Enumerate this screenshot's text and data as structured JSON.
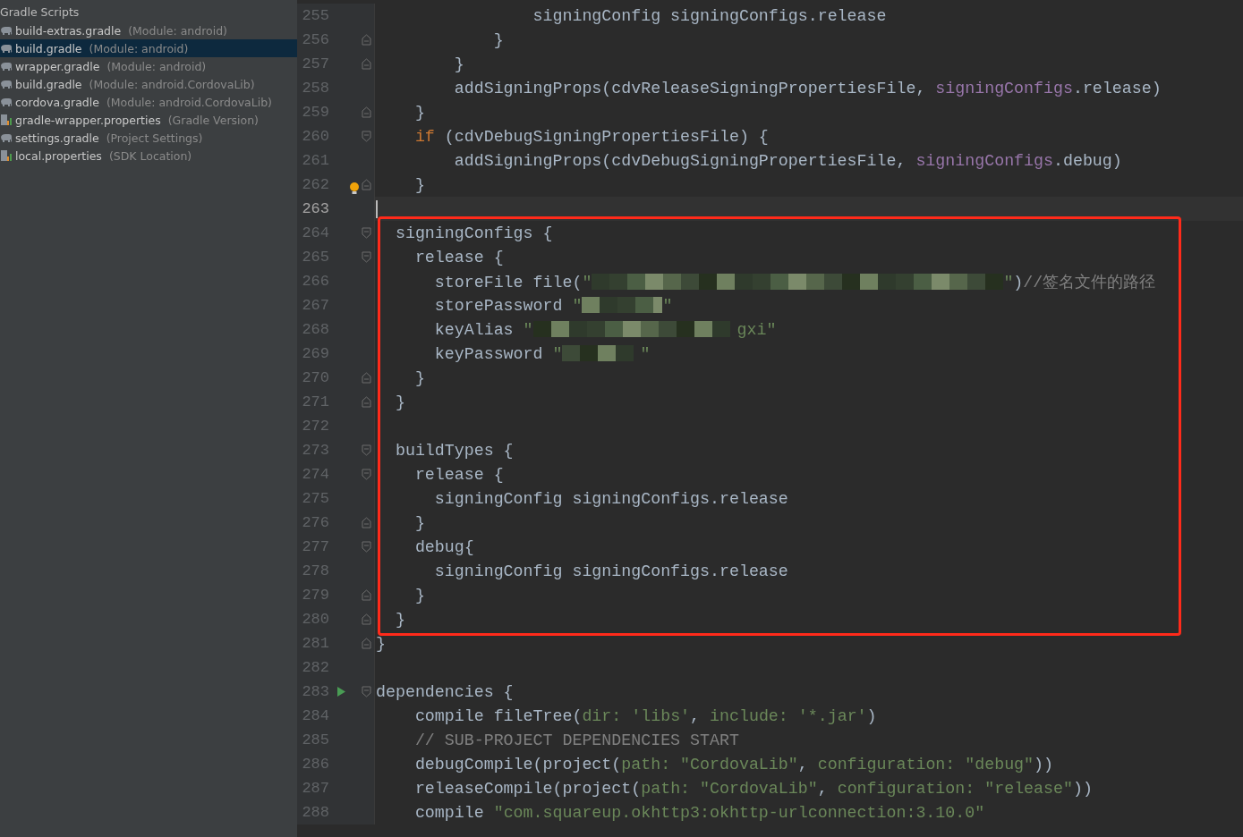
{
  "sidebar": {
    "header": "Gradle Scripts",
    "items": [
      {
        "name": "build-extras.gradle",
        "detail": "(Module: android)",
        "kind": "gradle",
        "selected": false
      },
      {
        "name": "build.gradle",
        "detail": "(Module: android)",
        "kind": "gradle",
        "selected": true
      },
      {
        "name": "wrapper.gradle",
        "detail": "(Module: android)",
        "kind": "gradle",
        "selected": false
      },
      {
        "name": "build.gradle",
        "detail": "(Module: android.CordovaLib)",
        "kind": "gradle",
        "selected": false
      },
      {
        "name": "cordova.gradle",
        "detail": "(Module: android.CordovaLib)",
        "kind": "gradle",
        "selected": false
      },
      {
        "name": "gradle-wrapper.properties",
        "detail": "(Gradle Version)",
        "kind": "properties",
        "selected": false
      },
      {
        "name": "settings.gradle",
        "detail": "(Project Settings)",
        "kind": "gradle",
        "selected": false
      },
      {
        "name": "local.properties",
        "detail": "(SDK Location)",
        "kind": "properties",
        "selected": false
      }
    ]
  },
  "editor": {
    "blocks": [
      {
        "kind": "plain",
        "lines": [
          {
            "number": "255",
            "current": false,
            "tokens": [
              {
                "text": "                signingConfig signingConfigs.release",
                "kind": "plain"
              }
            ]
          },
          {
            "number": "256",
            "current": false,
            "gutter_icons": [
              {
                "kind": "fold-end"
              }
            ],
            "tokens": [
              {
                "text": "            }",
                "kind": "plain"
              }
            ]
          },
          {
            "number": "257",
            "current": false,
            "gutter_icons": [
              {
                "kind": "fold-end"
              }
            ],
            "tokens": [
              {
                "text": "        }",
                "kind": "plain"
              }
            ]
          },
          {
            "number": "258",
            "current": false,
            "tokens": [
              {
                "text": "        addSigningProps(cdvReleaseSigningPropertiesFile, ",
                "kind": "plain"
              },
              {
                "text": "signingConfigs",
                "kind": "field"
              },
              {
                "text": ".release)",
                "kind": "plain"
              }
            ]
          },
          {
            "number": "259",
            "current": false,
            "gutter_icons": [
              {
                "kind": "fold-end"
              }
            ],
            "tokens": [
              {
                "text": "    }",
                "kind": "plain"
              }
            ]
          },
          {
            "number": "260",
            "current": false,
            "gutter_icons": [
              {
                "kind": "fold-start"
              }
            ],
            "tokens": [
              {
                "text": "    if",
                "kind": "keyword"
              },
              {
                "text": " (cdvDebugSigningPropertiesFile) {",
                "kind": "plain"
              }
            ]
          },
          {
            "number": "261",
            "current": false,
            "tokens": [
              {
                "text": "        addSigningProps(cdvDebugSigningPropertiesFile, ",
                "kind": "plain"
              },
              {
                "text": "signingConfigs",
                "kind": "field"
              },
              {
                "text": ".debug)",
                "kind": "plain"
              }
            ]
          },
          {
            "number": "262",
            "current": false,
            "gutter_icons": [
              {
                "kind": "bulb"
              },
              {
                "kind": "fold-end"
              }
            ],
            "tokens": [
              {
                "text": "    }",
                "kind": "plain"
              }
            ]
          },
          {
            "number": "263",
            "current": true
          }
        ]
      },
      {
        "kind": "boxed",
        "lines": [
          {
            "number": "264",
            "current": false,
            "gutter_icons": [
              {
                "kind": "fold-start"
              }
            ],
            "tokens": [
              {
                "text": "  signingConfigs {",
                "kind": "plain"
              }
            ]
          },
          {
            "number": "265",
            "current": false,
            "gutter_icons": [
              {
                "kind": "fold-start"
              }
            ],
            "tokens": [
              {
                "text": "    release {",
                "kind": "plain"
              }
            ]
          },
          {
            "number": "266",
            "current": false,
            "tokens": [
              {
                "text": "      storeFile file(",
                "kind": "plain"
              },
              {
                "text": "\"",
                "kind": "string"
              },
              {
                "kind": "redacted"
              },
              {
                "text": "\"",
                "kind": "string"
              },
              {
                "text": ")",
                "kind": "plain"
              },
              {
                "text": "//签名文件的路径",
                "kind": "comment"
              }
            ]
          },
          {
            "number": "267",
            "current": false,
            "tokens": [
              {
                "text": "      storePassword ",
                "kind": "plain"
              },
              {
                "text": "\"",
                "kind": "string"
              },
              {
                "kind": "redacted"
              },
              {
                "text": "\"",
                "kind": "string"
              }
            ]
          },
          {
            "number": "268",
            "current": false,
            "tokens": [
              {
                "text": "      keyAlias ",
                "kind": "plain"
              },
              {
                "text": "\"",
                "kind": "string"
              },
              {
                "kind": "redacted"
              },
              {
                "text": "gxi\"",
                "kind": "string"
              }
            ]
          },
          {
            "number": "269",
            "current": false,
            "tokens": [
              {
                "text": "      keyPassword ",
                "kind": "plain"
              },
              {
                "text": "\"",
                "kind": "string"
              },
              {
                "kind": "redacted"
              },
              {
                "text": "\"",
                "kind": "string"
              }
            ]
          },
          {
            "number": "270",
            "current": false,
            "gutter_icons": [
              {
                "kind": "fold-end"
              }
            ],
            "tokens": [
              {
                "text": "    }",
                "kind": "plain"
              }
            ]
          },
          {
            "number": "271",
            "current": false,
            "gutter_icons": [
              {
                "kind": "fold-end"
              }
            ],
            "tokens": [
              {
                "text": "  }",
                "kind": "plain"
              }
            ]
          },
          {
            "number": "272",
            "current": false
          },
          {
            "number": "273",
            "current": false,
            "gutter_icons": [
              {
                "kind": "fold-start"
              }
            ],
            "tokens": [
              {
                "text": "  buildTypes {",
                "kind": "plain"
              }
            ]
          },
          {
            "number": "274",
            "current": false,
            "gutter_icons": [
              {
                "kind": "fold-start"
              }
            ],
            "tokens": [
              {
                "text": "    release {",
                "kind": "plain"
              }
            ]
          },
          {
            "number": "275",
            "current": false,
            "tokens": [
              {
                "text": "      signingConfig signingConfigs.release",
                "kind": "plain"
              }
            ]
          },
          {
            "number": "276",
            "current": false,
            "gutter_icons": [
              {
                "kind": "fold-end"
              }
            ],
            "tokens": [
              {
                "text": "    }",
                "kind": "plain"
              }
            ]
          },
          {
            "number": "277",
            "current": false,
            "gutter_icons": [
              {
                "kind": "fold-start"
              }
            ],
            "tokens": [
              {
                "text": "    debug{",
                "kind": "plain"
              }
            ]
          },
          {
            "number": "278",
            "current": false,
            "tokens": [
              {
                "text": "      signingConfig signingConfigs.release",
                "kind": "plain"
              }
            ]
          },
          {
            "number": "279",
            "current": false,
            "gutter_icons": [
              {
                "kind": "fold-end"
              }
            ],
            "tokens": [
              {
                "text": "    }",
                "kind": "plain"
              }
            ]
          },
          {
            "number": "280",
            "current": false,
            "gutter_icons": [
              {
                "kind": "fold-end"
              }
            ],
            "tokens": [
              {
                "text": "  }",
                "kind": "plain"
              }
            ]
          }
        ]
      },
      {
        "kind": "plain",
        "lines": [
          {
            "number": "281",
            "current": false,
            "gutter_icons": [
              {
                "kind": "fold-end"
              }
            ],
            "tokens": [
              {
                "text": "}",
                "kind": "plain"
              }
            ]
          },
          {
            "number": "282",
            "current": false
          },
          {
            "number": "283",
            "current": false,
            "gutter_icons": [
              {
                "kind": "run"
              },
              {
                "kind": "fold-start"
              }
            ],
            "tokens": [
              {
                "text": "dependencies {",
                "kind": "plain"
              }
            ]
          },
          {
            "number": "284",
            "current": false,
            "tokens": [
              {
                "text": "    compile fileTree(",
                "kind": "plain"
              },
              {
                "text": "dir: ",
                "kind": "param"
              },
              {
                "text": "'libs'",
                "kind": "string"
              },
              {
                "text": ", ",
                "kind": "plain"
              },
              {
                "text": "include: ",
                "kind": "param"
              },
              {
                "text": "'*.jar'",
                "kind": "string"
              },
              {
                "text": ")",
                "kind": "plain"
              }
            ]
          },
          {
            "number": "285",
            "current": false,
            "tokens": [
              {
                "text": "    // SUB-PROJECT DEPENDENCIES START",
                "kind": "comment"
              }
            ]
          },
          {
            "number": "286",
            "current": false,
            "tokens": [
              {
                "text": "    debugCompile(project(",
                "kind": "plain"
              },
              {
                "text": "path: ",
                "kind": "param"
              },
              {
                "text": "\"CordovaLib\"",
                "kind": "string"
              },
              {
                "text": ", ",
                "kind": "plain"
              },
              {
                "text": "configuration: ",
                "kind": "param"
              },
              {
                "text": "\"debug\"",
                "kind": "string"
              },
              {
                "text": "))",
                "kind": "plain"
              }
            ]
          },
          {
            "number": "287",
            "current": false,
            "tokens": [
              {
                "text": "    releaseCompile(project(",
                "kind": "plain"
              },
              {
                "text": "path: ",
                "kind": "param"
              },
              {
                "text": "\"CordovaLib\"",
                "kind": "string"
              },
              {
                "text": ", ",
                "kind": "plain"
              },
              {
                "text": "configuration: ",
                "kind": "param"
              },
              {
                "text": "\"release\"",
                "kind": "string"
              },
              {
                "text": "))",
                "kind": "plain"
              }
            ]
          },
          {
            "number": "288",
            "current": false,
            "tokens": [
              {
                "text": "    compile ",
                "kind": "plain"
              },
              {
                "text": "\"com.squareup.okhttp3:okhttp-urlconnection:3.10.0\"",
                "kind": "string"
              }
            ]
          }
        ]
      }
    ]
  }
}
